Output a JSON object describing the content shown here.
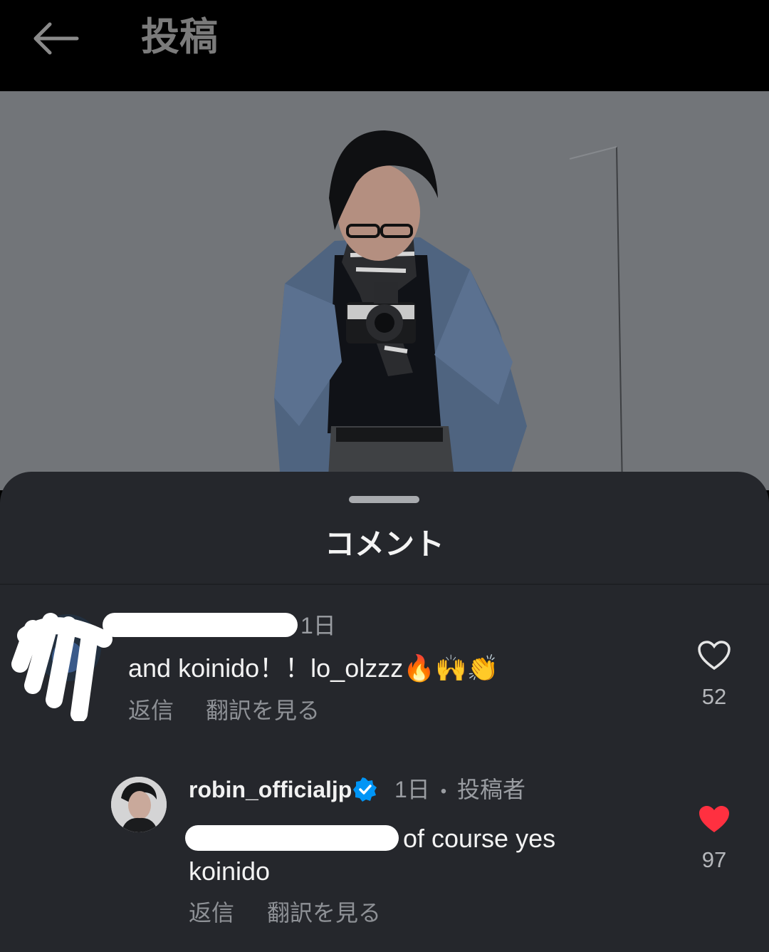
{
  "header": {
    "title": "投稿",
    "back_icon": "arrow-left-icon"
  },
  "sheet": {
    "title": "コメント"
  },
  "comments": [
    {
      "username": "",
      "time": "1日",
      "text": "and koinido！！lo_olzzz🔥🙌👏",
      "reply_label": "返信",
      "translate_label": "翻訳を見る",
      "likes": "52",
      "liked": false
    },
    {
      "username": "robin_officialjp",
      "verified": true,
      "time": "1日",
      "separator": "•",
      "badge": "投稿者",
      "text_line1": "s of course yes",
      "text_line2": "koinido",
      "reply_label": "返信",
      "translate_label": "翻訳を見る",
      "likes": "97",
      "liked": true
    }
  ],
  "colors": {
    "sheet_bg": "#25272c",
    "liked_heart": "#ff3040",
    "verified": "#0095f6"
  }
}
